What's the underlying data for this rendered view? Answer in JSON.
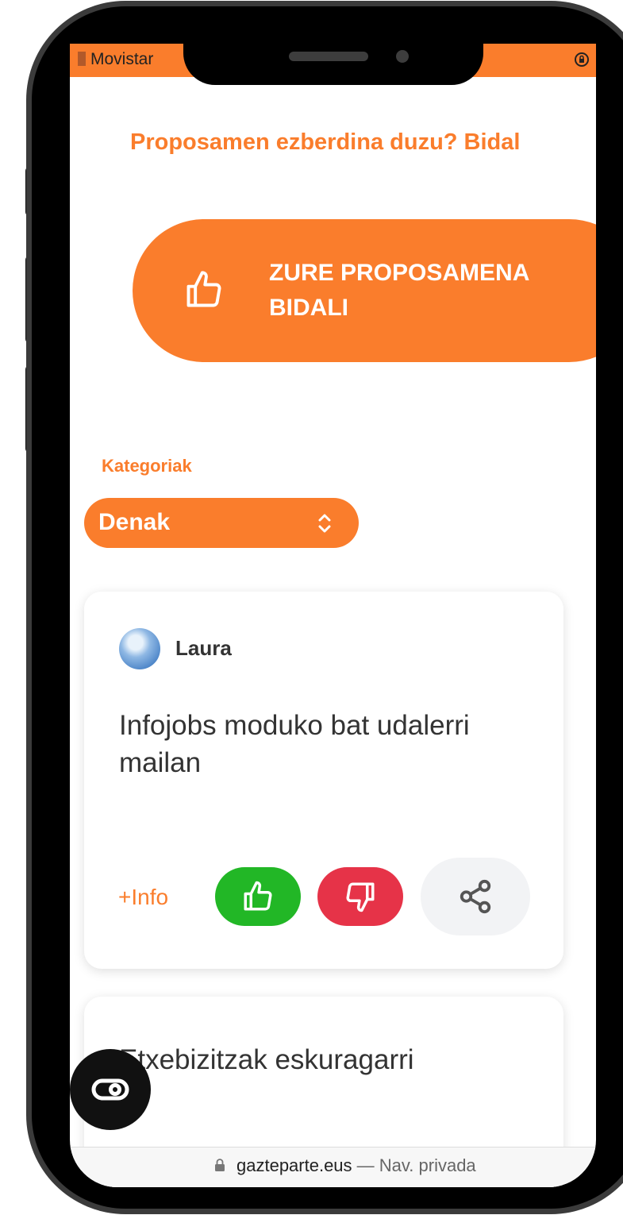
{
  "status_bar": {
    "carrier": "Movistar"
  },
  "promo": {
    "text": "Proposamen ezberdina duzu? Bidal"
  },
  "cta": {
    "label": "ZURE PROPOSAMENA BIDALI",
    "icon": "thumbs-up-icon"
  },
  "categories": {
    "label": "Kategoriak",
    "selected": "Denak"
  },
  "cards": [
    {
      "author": "Laura",
      "title": "Infojobs moduko bat udalerri mailan",
      "more_info": "+Info",
      "like_icon": "thumbs-up-icon",
      "dislike_icon": "thumbs-down-icon",
      "share_icon": "share-icon"
    },
    {
      "title": "Etxebizitzak eskuragarri"
    }
  ],
  "browser": {
    "domain": "gazteparte.eus",
    "separator": "—",
    "mode": "Nav. privada"
  },
  "colors": {
    "accent": "#fa7d2c",
    "like": "#22b726",
    "dislike": "#e63348",
    "share_bg": "#f2f3f5"
  }
}
